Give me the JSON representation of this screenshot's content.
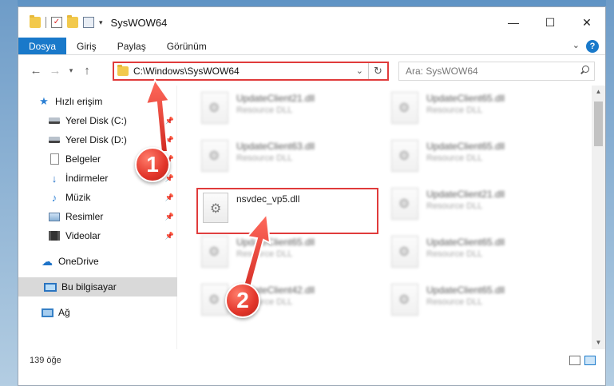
{
  "window": {
    "title": "SysWOW64",
    "controls": {
      "minimize": "—",
      "maximize": "☐",
      "close": "✕"
    }
  },
  "ribbon": {
    "tabs": [
      {
        "label": "Dosya",
        "active": true
      },
      {
        "label": "Giriş"
      },
      {
        "label": "Paylaş"
      },
      {
        "label": "Görünüm"
      }
    ],
    "help": "?"
  },
  "navigation": {
    "address": "C:\\Windows\\SysWOW64",
    "search_placeholder": "Ara: SysWOW64"
  },
  "sidebar": {
    "items": [
      {
        "label": "Hızlı erişim",
        "icon": "star-icon"
      },
      {
        "label": "Yerel Disk (C:)",
        "icon": "disk-icon",
        "pinned": true
      },
      {
        "label": "Yerel Disk (D:)",
        "icon": "disk-icon",
        "pinned": true
      },
      {
        "label": "Belgeler",
        "icon": "document-icon",
        "pinned": true
      },
      {
        "label": "İndirmeler",
        "icon": "download-icon",
        "pinned": true
      },
      {
        "label": "Müzik",
        "icon": "music-icon",
        "pinned": true
      },
      {
        "label": "Resimler",
        "icon": "pictures-icon",
        "pinned": true
      },
      {
        "label": "Videolar",
        "icon": "videos-icon",
        "pinned": true
      },
      {
        "label": "OneDrive",
        "icon": "cloud-icon"
      },
      {
        "label": "Bu bilgisayar",
        "icon": "computer-icon",
        "selected": true
      },
      {
        "label": "Ağ",
        "icon": "network-icon"
      }
    ]
  },
  "files": [
    {
      "name": "UpdateClient21.dll",
      "desc": "Resource DLL"
    },
    {
      "name": "UpdateClient65.dll",
      "desc": "Resource DLL"
    },
    {
      "name": "UpdateClient63.dll",
      "desc": "Resource DLL"
    },
    {
      "name": "UpdateClient65.dll",
      "desc": "Resource DLL"
    },
    {
      "name": "nsvdec_vp5.dll",
      "desc": ""
    },
    {
      "name": "UpdateClient21.dll",
      "desc": "Resource DLL"
    },
    {
      "name": "UpdateClient65.dll",
      "desc": "Resource DLL"
    },
    {
      "name": "UpdateClient65.dll",
      "desc": "Resource DLL"
    },
    {
      "name": "UpdateClient42.dll",
      "desc": "Resource DLL"
    },
    {
      "name": "UpdateClient65.dll",
      "desc": "Resource DLL"
    }
  ],
  "status": {
    "count": "139 öğe"
  },
  "annotations": {
    "step1": "1",
    "step2": "2",
    "color": "#e03b3b"
  }
}
